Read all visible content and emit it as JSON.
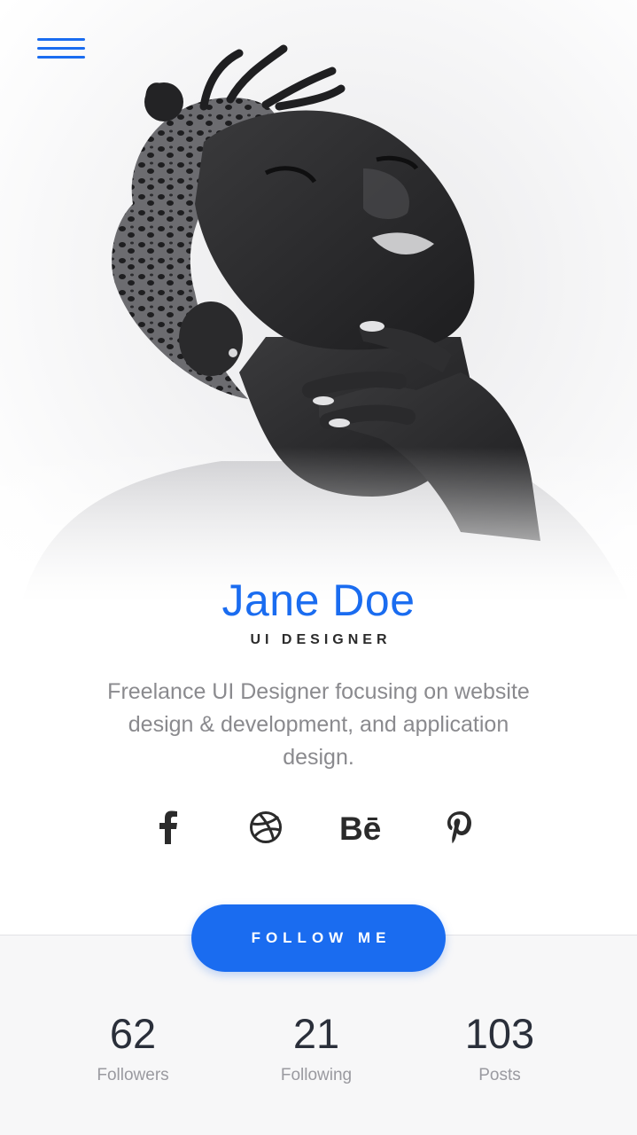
{
  "colors": {
    "accent": "#1a6cf0",
    "text_dark": "#2b2b2b",
    "text_muted": "#8a8a8e"
  },
  "header": {
    "menu_icon": "hamburger-menu-icon"
  },
  "profile": {
    "name": "Jane Doe",
    "role": "UI DESIGNER",
    "bio": "Freelance UI Designer focusing on website design & development, and application design."
  },
  "social": [
    {
      "icon": "facebook-icon"
    },
    {
      "icon": "dribbble-icon"
    },
    {
      "icon": "behance-icon",
      "glyph": "Bē"
    },
    {
      "icon": "pinterest-icon"
    }
  ],
  "cta": {
    "follow_label": "FOLLOW ME"
  },
  "stats": [
    {
      "value": "62",
      "label": "Followers"
    },
    {
      "value": "21",
      "label": "Following"
    },
    {
      "value": "103",
      "label": "Posts"
    }
  ]
}
